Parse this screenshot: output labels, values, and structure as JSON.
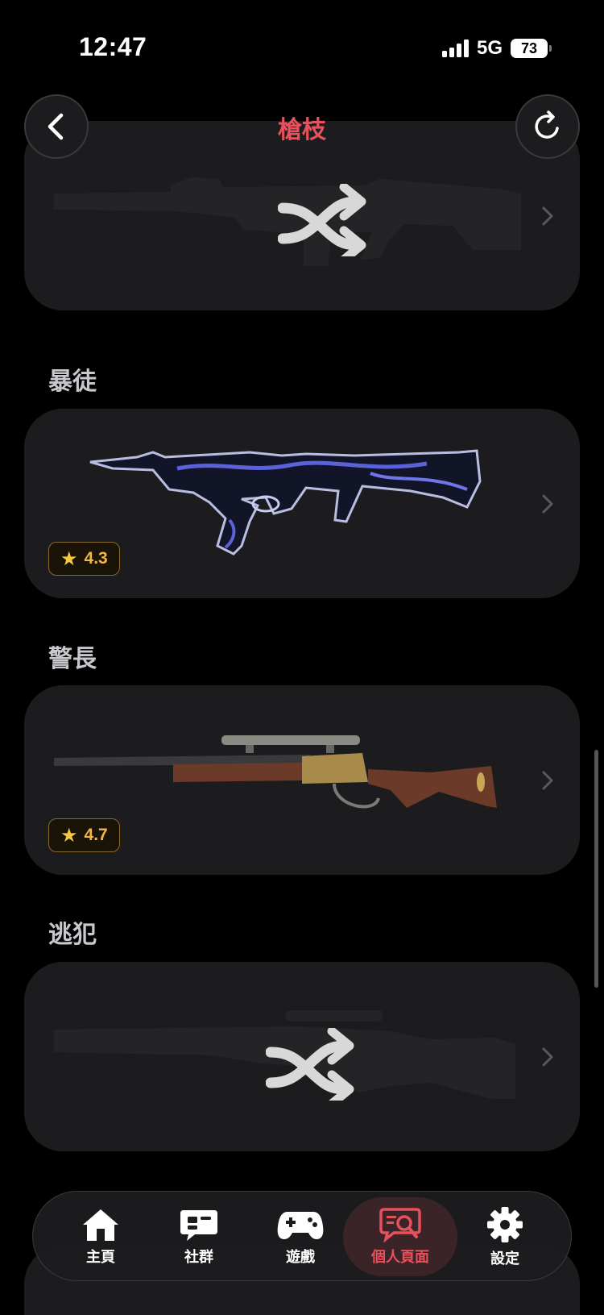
{
  "status_bar": {
    "time": "12:47",
    "network": "5G",
    "battery": "73"
  },
  "header": {
    "title": "槍枝"
  },
  "sections": [
    {
      "title": "",
      "rating": null
    },
    {
      "title": "暴徒",
      "rating": "4.3"
    },
    {
      "title": "警長",
      "rating": "4.7"
    },
    {
      "title": "逃犯",
      "rating": null
    }
  ],
  "tabs": [
    {
      "label": "主頁",
      "icon": "home-icon"
    },
    {
      "label": "社群",
      "icon": "chat-icon"
    },
    {
      "label": "遊戲",
      "icon": "gamepad-icon"
    },
    {
      "label": "個人頁面",
      "icon": "profile-search-icon",
      "active": true
    },
    {
      "label": "設定",
      "icon": "gear-icon"
    }
  ],
  "colors": {
    "accent": "#e8505b",
    "rating": "#f3b53f",
    "card": "#1c1c1e"
  }
}
